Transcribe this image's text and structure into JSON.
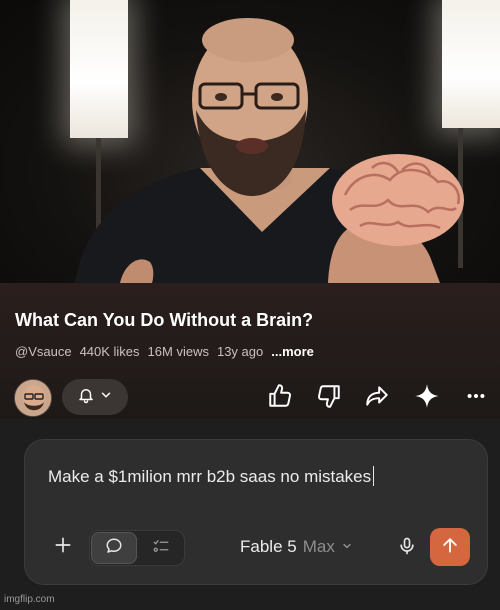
{
  "video": {
    "title": "What Can You Do Without a Brain?",
    "channel": "@Vsauce",
    "likes": "440K likes",
    "views": "16M views",
    "age": "13y ago",
    "more": "...more"
  },
  "actions": {
    "subscribe_icon": "bell-icon",
    "like_icon": "thumbs-up-icon",
    "dislike_icon": "thumbs-down-icon",
    "share_icon": "share-icon",
    "ask_icon": "sparkle-icon",
    "more_icon": "more-horizontal-icon"
  },
  "composer": {
    "text": "Make a $1milion mrr b2b saas no mistakes",
    "model_name": "Fable 5",
    "model_variant": "Max",
    "send_color": "#d4673f"
  },
  "watermark": "imgflip.com"
}
